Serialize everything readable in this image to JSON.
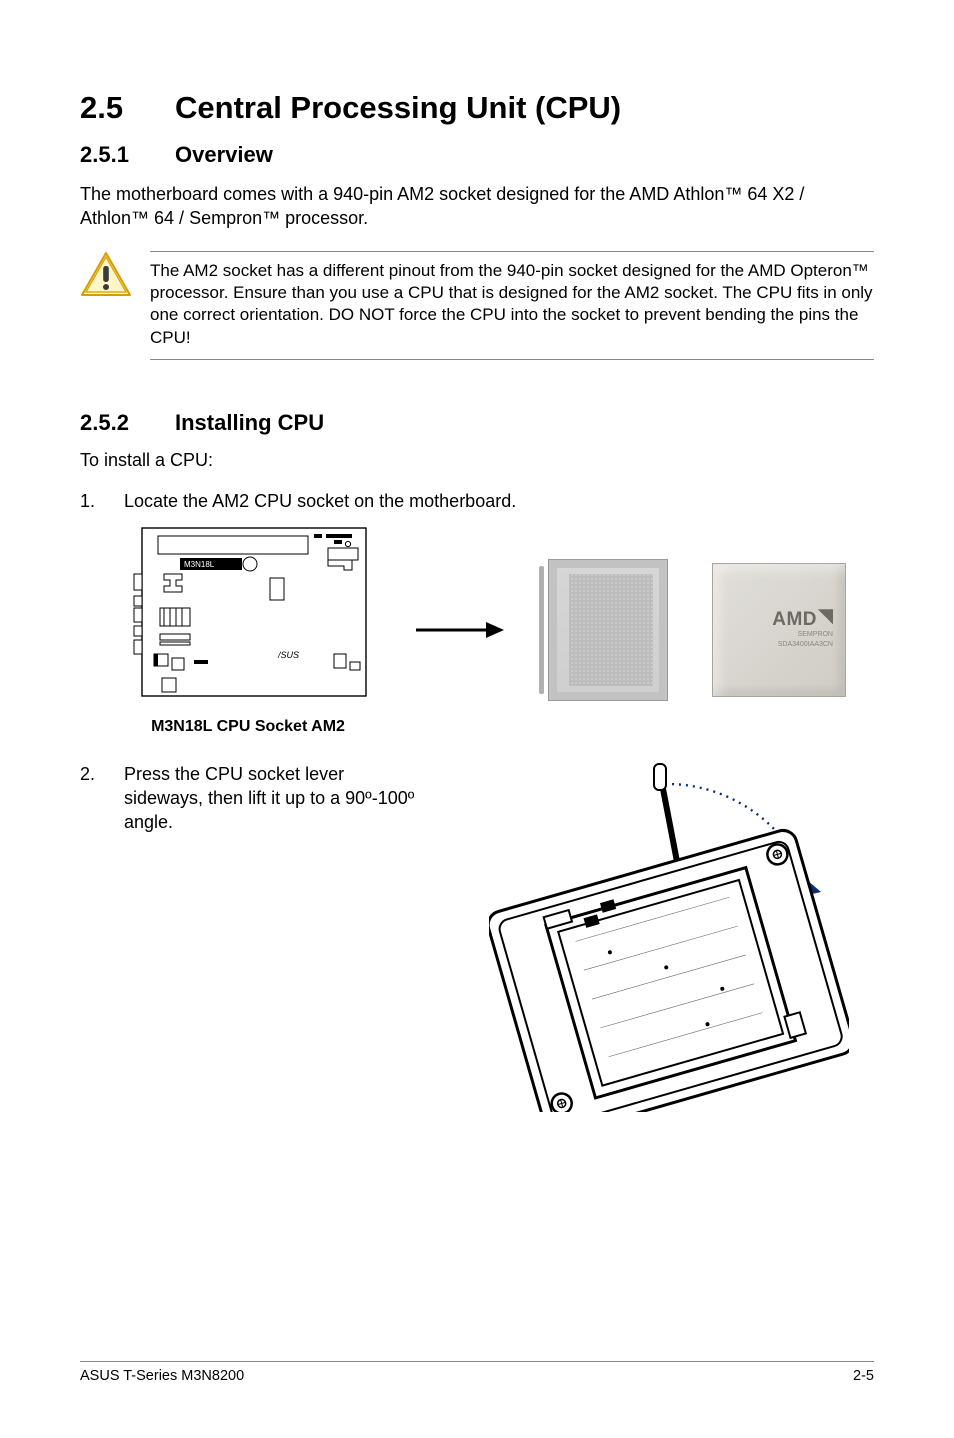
{
  "heading": {
    "number": "2.5",
    "title": "Central Processing Unit (CPU)"
  },
  "section1": {
    "number": "2.5.1",
    "title": "Overview",
    "body": "The motherboard comes with a 940-pin AM2 socket designed for the AMD Athlon™ 64 X2 / Athlon™ 64 / Sempron™ processor."
  },
  "warning": {
    "text": "The AM2 socket has a different pinout from the 940-pin socket designed for the AMD Opteron™ processor. Ensure than you use a CPU that is designed for the AM2 socket. The CPU fits in only one correct orientation. DO NOT force the CPU into the socket to prevent bending the pins the CPU!"
  },
  "section2": {
    "number": "2.5.2",
    "title": "Installing CPU",
    "intro": "To install a CPU:",
    "steps": [
      {
        "num": "1.",
        "text": "Locate the AM2 CPU socket on the motherboard."
      },
      {
        "num": "2.",
        "text": "Press the CPU socket lever sideways, then lift it up to a 90º-100º angle."
      }
    ]
  },
  "mobo": {
    "label_on_board": "M3N18L",
    "brand_on_board": "/SUS",
    "caption": "M3N18L CPU Socket AM2"
  },
  "cpu": {
    "brand": "AMD",
    "sub1": "SEMPRON",
    "sub2": "SDA3400IAA3CN"
  },
  "footer": {
    "left": "ASUS T-Series M3N8200",
    "right": "2-5"
  }
}
